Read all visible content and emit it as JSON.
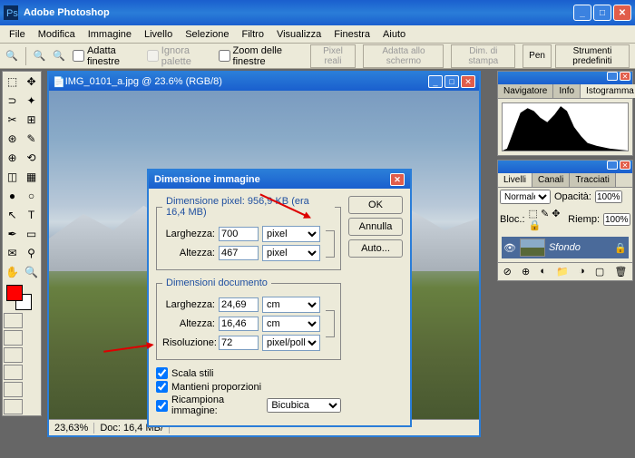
{
  "app": {
    "title": "Adobe Photoshop"
  },
  "menu": [
    "File",
    "Modifica",
    "Immagine",
    "Livello",
    "Selezione",
    "Filtro",
    "Visualizza",
    "Finestra",
    "Aiuto"
  ],
  "optbar": {
    "adatta_finestre": "Adatta finestre",
    "ignora_palette": "Ignora palette",
    "zoom_delle_finestre": "Zoom delle finestre",
    "pixel_reali": "Pixel reali",
    "adatta_schermo": "Adatta allo schermo",
    "dim_stampa": "Dim. di stampa",
    "pen": "Pen",
    "strumenti": "Strumenti predefiniti"
  },
  "doc": {
    "title": "IMG_0101_a.jpg @ 23.6% (RGB/8)",
    "zoom": "23,63%",
    "docinfo": "Doc: 16,4 MB/"
  },
  "dialog": {
    "title": "Dimensione immagine",
    "pixel_legend": "Dimensione pixel:  956,9 KB (era 16,4 MB)",
    "doc_legend": "Dimensioni documento",
    "larghezza": "Larghezza:",
    "altezza": "Altezza:",
    "risoluzione": "Risoluzione:",
    "pixel": "pixel",
    "cm": "cm",
    "pixelpollice": "pixel/pollice",
    "bicubica": "Bicubica",
    "w_px": "700",
    "h_px": "467",
    "w_cm": "24,69",
    "h_cm": "16,46",
    "res": "72",
    "scala_stili": "Scala stili",
    "mantieni_prop": "Mantieni proporzioni",
    "ricampiona": "Ricampiona immagine:",
    "ok": "OK",
    "annulla": "Annulla",
    "auto": "Auto..."
  },
  "panels": {
    "nav_tabs": [
      "Navigatore",
      "Info",
      "Istogramma"
    ],
    "layer_tabs": [
      "Livelli",
      "Canali",
      "Tracciati"
    ],
    "normale": "Normale",
    "opacita": "Opacità:",
    "opacita_val": "100%",
    "bloc": "Bloc.:",
    "riemp": "Riemp:",
    "riemp_val": "100%",
    "sfondo": "Sfondo"
  }
}
